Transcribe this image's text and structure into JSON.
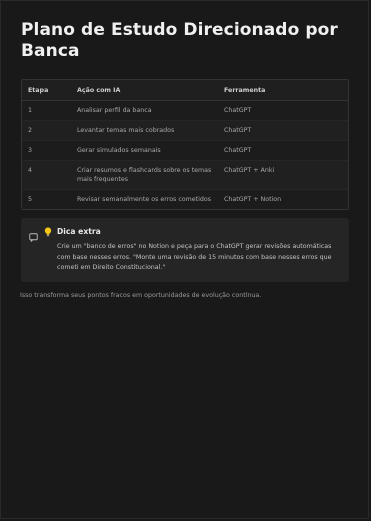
{
  "page": {
    "title": "Plano de Estudo Direcionado por Banca"
  },
  "table": {
    "headers": [
      "Etapa",
      "Ação com IA",
      "Ferramenta"
    ],
    "rows": [
      {
        "etapa": "1",
        "acao": "Analisar perfil da banca",
        "ferramenta": "ChatGPT"
      },
      {
        "etapa": "2",
        "acao": "Levantar temas mais cobrados",
        "ferramenta": "ChatGPT"
      },
      {
        "etapa": "3",
        "acao": "Gerar simulados semanais",
        "ferramenta": "ChatGPT"
      },
      {
        "etapa": "4",
        "acao": "Criar resumos e flashcards sobre os temas mais frequentes",
        "ferramenta": "ChatGPT + Anki"
      },
      {
        "etapa": "5",
        "acao": "Revisar semanalmente os erros cometidos",
        "ferramenta": "ChatGPT + Notion"
      }
    ]
  },
  "callout": {
    "icon": "bulb-icon",
    "title": "Dica extra",
    "text": "Crie um \"banco de erros\" no Notion e peça para o ChatGPT gerar revisões automáticas com base nesses erros. \"Monte uma revisão de 15 minutos com base nesses erros que cometi em Direito Constitucional.\""
  },
  "footer": {
    "text": "Isso transforma seus pontos fracos em oportunidades de evolução contínua."
  },
  "colors": {
    "background": "#191919",
    "callout_background": "#252525",
    "bulb": "#f5c518"
  }
}
